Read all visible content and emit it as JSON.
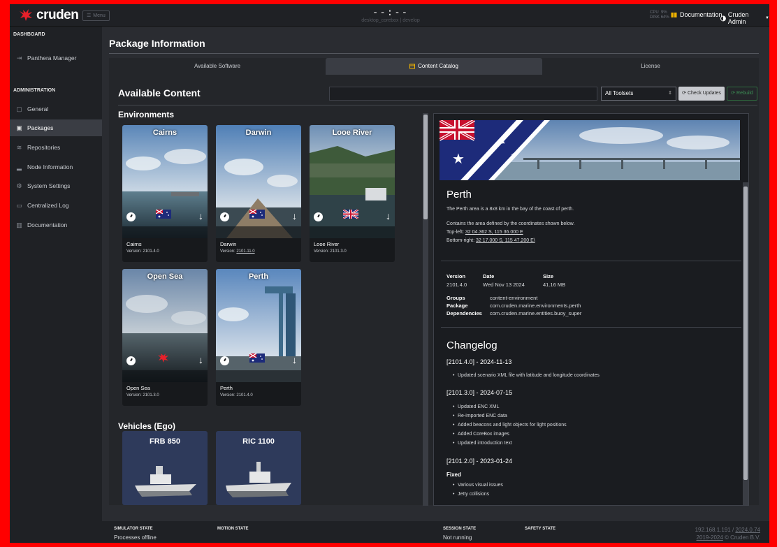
{
  "topbar": {
    "logo_text": "cruden",
    "menu_label": "Menu",
    "clock": "--:--",
    "host": "desktop_corebox | develop",
    "cpu_label": "CPU",
    "cpu_value": "9%",
    "disk_label": "DISK",
    "disk_value": "64%",
    "documentation_label": "Documentation",
    "user_label": "Cruden Admin"
  },
  "sidebar": {
    "dashboard_heading": "DASHBOARD",
    "dashboard_items": [
      {
        "label": "Panthera Manager",
        "icon": "sign-in-icon"
      }
    ],
    "admin_heading": "ADMINISTRATION",
    "admin_items": [
      {
        "label": "General",
        "icon": "square-icon"
      },
      {
        "label": "Packages",
        "icon": "package-icon",
        "active": true
      },
      {
        "label": "Repositories",
        "icon": "database-icon"
      },
      {
        "label": "Node Information",
        "icon": "bar-chart-icon"
      },
      {
        "label": "System Settings",
        "icon": "gear-icon"
      },
      {
        "label": "Centralized Log",
        "icon": "comment-icon"
      },
      {
        "label": "Documentation",
        "icon": "book-icon"
      }
    ]
  },
  "main": {
    "page_title": "Package Information",
    "tabs": [
      {
        "label": "Available Software"
      },
      {
        "label": "Content Catalog",
        "active": true
      },
      {
        "label": "License"
      }
    ],
    "available_content_title": "Available Content",
    "search_placeholder": "",
    "toolset_select": "All Toolsets",
    "check_updates_label": "Check Updates",
    "rebuild_label": "Rebuild",
    "environments_title": "Environments",
    "vehicles_title": "Vehicles (Ego)",
    "environments": [
      {
        "name": "Cairns",
        "label": "Cairns",
        "version_prefix": "Version: ",
        "version": "2101.4.0",
        "flag": "au",
        "underlined": false
      },
      {
        "name": "Darwin",
        "label": "Darwin",
        "version_prefix": "Version: ",
        "version": "2101.11.0",
        "flag": "au",
        "underlined": true
      },
      {
        "name": "Looe River",
        "label": "Looe River",
        "version_prefix": "Version: ",
        "version": "2101.3.0",
        "flag": "uk",
        "underlined": false
      },
      {
        "name": "Open Sea",
        "label": "Open Sea",
        "version_prefix": "Version: ",
        "version": "2101.3.0",
        "flag": "cruden",
        "underlined": false
      },
      {
        "name": "Perth",
        "label": "Perth",
        "version_prefix": "Version: ",
        "version": "2101.4.0",
        "flag": "au",
        "underlined": false
      }
    ],
    "vehicles": [
      {
        "name": "FRB 850"
      },
      {
        "name": "RIC 1100"
      }
    ]
  },
  "details": {
    "title": "Perth",
    "description": "The Perth area is a 8x8 km in the bay of the coast of perth.",
    "contains": "Contains the area defined by the coordinates shown below.",
    "top_left_label": "Top-left: ",
    "top_left": "32 04.362 S, 115 36.000 E",
    "bottom_right_label": "Bottom-right: ",
    "bottom_right": "32 17.000 S, 115 47.200 E\\",
    "version_key": "Version",
    "version": "2101.4.0",
    "date_key": "Date",
    "date": "Wed Nov 13 2024",
    "size_key": "Size",
    "size": "41.16 MB",
    "groups_key": "Groups",
    "groups": "content-environment",
    "package_key": "Package",
    "package": "com.cruden.marine.environments.perth",
    "dependencies_key": "Dependencies",
    "dependencies": "com.cruden.marine.entities.buoy_super",
    "changelog_title": "Changelog",
    "changelog": [
      {
        "version": "[2101.4.0] - 2024-11-13",
        "items": [
          "Updated scenario XML file with latitude and longitude coordinates"
        ]
      },
      {
        "version": "[2101.3.0] - 2024-07-15",
        "items": [
          "Updated ENC XML",
          "Re-imported ENC data",
          "Added beacons and light objects for light positions",
          "Added CoreBox images",
          "Updated introduction text"
        ]
      },
      {
        "version": "[2101.2.0] - 2023-01-24",
        "fixed_label": "Fixed",
        "items": [
          "Various visual issues",
          "Jetty collisions"
        ]
      }
    ]
  },
  "statusbar": {
    "simulator_state_key": "SIMULATOR STATE",
    "simulator_state": "Processes offline",
    "motion_state_key": "MOTION STATE",
    "session_state_key": "SESSION STATE",
    "session_state": "Not running",
    "safety_state_key": "SAFETY STATE",
    "ip": "192.168.1.191 / ",
    "build": "2024.0.74",
    "copyright_years": "2019-2024",
    "copyright_holder": " © Cruden B.V."
  }
}
